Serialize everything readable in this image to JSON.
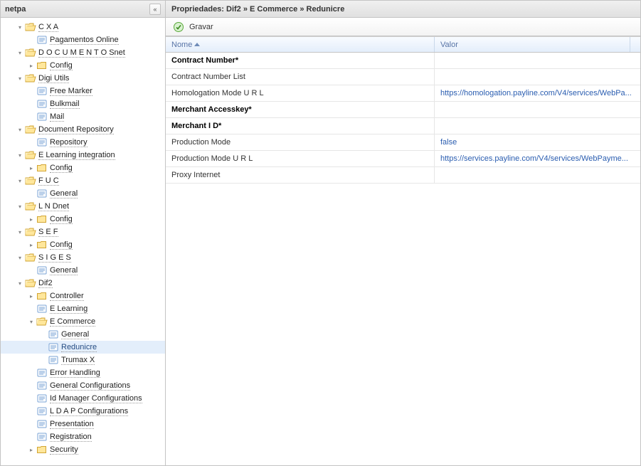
{
  "sidebar": {
    "title": "netpa",
    "collapse_glyph": "«",
    "toggle_expanded": "▾",
    "toggle_collapsed": "▸"
  },
  "tree": [
    {
      "depth": 1,
      "toggle": "expanded",
      "icon": "folder-open",
      "label": "C X A"
    },
    {
      "depth": 2,
      "toggle": "none",
      "icon": "item",
      "label": "Pagamentos Online"
    },
    {
      "depth": 1,
      "toggle": "expanded",
      "icon": "folder-open",
      "label": "D O C U M E N T O Snet"
    },
    {
      "depth": 2,
      "toggle": "collapsed",
      "icon": "folder",
      "label": "Config"
    },
    {
      "depth": 1,
      "toggle": "expanded",
      "icon": "folder-open",
      "label": "Digi Utils"
    },
    {
      "depth": 2,
      "toggle": "none",
      "icon": "item",
      "label": "Free Marker"
    },
    {
      "depth": 2,
      "toggle": "none",
      "icon": "item",
      "label": "Bulkmail"
    },
    {
      "depth": 2,
      "toggle": "none",
      "icon": "item",
      "label": "Mail"
    },
    {
      "depth": 1,
      "toggle": "expanded",
      "icon": "folder-open",
      "label": "Document Repository"
    },
    {
      "depth": 2,
      "toggle": "none",
      "icon": "item",
      "label": "Repository"
    },
    {
      "depth": 1,
      "toggle": "expanded",
      "icon": "folder-open",
      "label": "E Learning integration"
    },
    {
      "depth": 2,
      "toggle": "collapsed",
      "icon": "folder",
      "label": "Config"
    },
    {
      "depth": 1,
      "toggle": "expanded",
      "icon": "folder-open",
      "label": "F U C"
    },
    {
      "depth": 2,
      "toggle": "none",
      "icon": "item",
      "label": "General"
    },
    {
      "depth": 1,
      "toggle": "expanded",
      "icon": "folder-open",
      "label": "L N Dnet"
    },
    {
      "depth": 2,
      "toggle": "collapsed",
      "icon": "folder",
      "label": "Config"
    },
    {
      "depth": 1,
      "toggle": "expanded",
      "icon": "folder-open",
      "label": "S E F"
    },
    {
      "depth": 2,
      "toggle": "collapsed",
      "icon": "folder",
      "label": "Config"
    },
    {
      "depth": 1,
      "toggle": "expanded",
      "icon": "folder-open",
      "label": "S I G E S"
    },
    {
      "depth": 2,
      "toggle": "none",
      "icon": "item",
      "label": "General"
    },
    {
      "depth": 1,
      "toggle": "expanded",
      "icon": "folder-open",
      "label": "Dif2"
    },
    {
      "depth": 2,
      "toggle": "collapsed",
      "icon": "folder",
      "label": "Controller"
    },
    {
      "depth": 2,
      "toggle": "none",
      "icon": "item",
      "label": "E Learning"
    },
    {
      "depth": 2,
      "toggle": "expanded",
      "icon": "folder-open",
      "label": "E Commerce"
    },
    {
      "depth": 3,
      "toggle": "none",
      "icon": "item",
      "label": "General"
    },
    {
      "depth": 3,
      "toggle": "none",
      "icon": "item",
      "label": "Redunicre",
      "selected": true
    },
    {
      "depth": 3,
      "toggle": "none",
      "icon": "item",
      "label": "Trumax X"
    },
    {
      "depth": 2,
      "toggle": "none",
      "icon": "item",
      "label": "Error Handling"
    },
    {
      "depth": 2,
      "toggle": "none",
      "icon": "item",
      "label": "General Configurations"
    },
    {
      "depth": 2,
      "toggle": "none",
      "icon": "item",
      "label": "Id Manager Configurations"
    },
    {
      "depth": 2,
      "toggle": "none",
      "icon": "item",
      "label": "L D A P Configurations"
    },
    {
      "depth": 2,
      "toggle": "none",
      "icon": "item",
      "label": "Presentation"
    },
    {
      "depth": 2,
      "toggle": "none",
      "icon": "item",
      "label": "Registration"
    },
    {
      "depth": 2,
      "toggle": "collapsed",
      "icon": "folder",
      "label": "Security"
    }
  ],
  "main": {
    "title": "Propriedades: Dif2 » E Commerce » Redunicre",
    "toolbar": {
      "save_label": "Gravar"
    },
    "columns": {
      "nome": "Nome",
      "valor": "Valor"
    },
    "rows": [
      {
        "nome": "Contract Number*",
        "valor": "",
        "bold": true
      },
      {
        "nome": "Contract Number List",
        "valor": "",
        "bold": false
      },
      {
        "nome": "Homologation Mode U R L",
        "valor": "https://homologation.payline.com/V4/services/WebPa...",
        "bold": false
      },
      {
        "nome": "Merchant Accesskey*",
        "valor": "",
        "bold": true
      },
      {
        "nome": "Merchant I D*",
        "valor": "",
        "bold": true
      },
      {
        "nome": "Production Mode",
        "valor": "false",
        "bold": false
      },
      {
        "nome": "Production Mode U R L",
        "valor": "https://services.payline.com/V4/services/WebPayme...",
        "bold": false
      },
      {
        "nome": "Proxy Internet",
        "valor": "",
        "bold": false
      }
    ]
  }
}
